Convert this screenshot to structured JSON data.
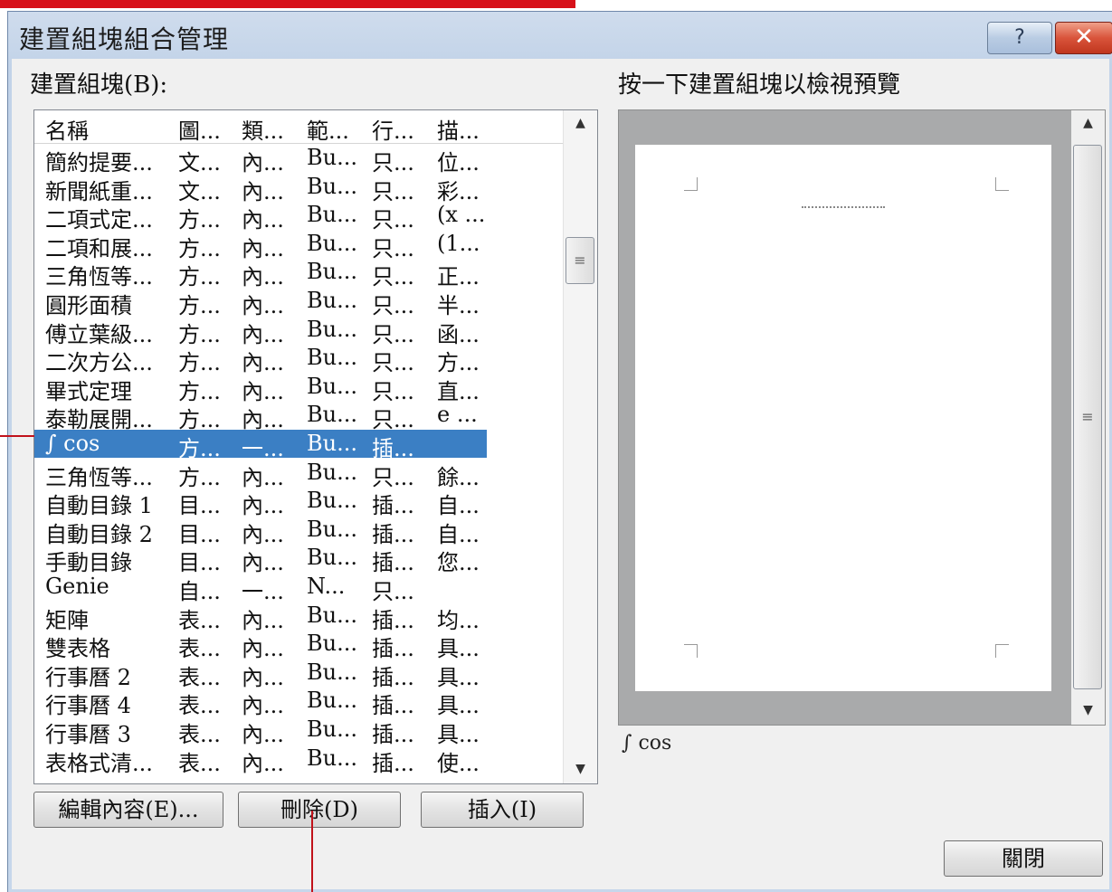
{
  "window": {
    "title": "建置組塊組合管理",
    "help_label": "?",
    "close_label": "✕"
  },
  "list_label": "建置組塊(B):",
  "preview_label": "按一下建置組塊以檢視預覽",
  "columns": [
    "名稱",
    "圖...",
    "類...",
    "範...",
    "行...",
    "描..."
  ],
  "rows": [
    [
      "簡約提要...",
      "文...",
      "內...",
      "Bu...",
      "只...",
      "位..."
    ],
    [
      "新聞紙重...",
      "文...",
      "內...",
      "Bu...",
      "只...",
      "彩..."
    ],
    [
      "二項式定...",
      "方...",
      "內...",
      "Bu...",
      "只...",
      "(x ..."
    ],
    [
      "二項和展...",
      "方...",
      "內...",
      "Bu...",
      "只...",
      "(1..."
    ],
    [
      "三角恆等...",
      "方...",
      "內...",
      "Bu...",
      "只...",
      "正..."
    ],
    [
      "圓形面積",
      "方...",
      "內...",
      "Bu...",
      "只...",
      "半..."
    ],
    [
      "傅立葉級...",
      "方...",
      "內...",
      "Bu...",
      "只...",
      "函..."
    ],
    [
      "二次方公...",
      "方...",
      "內...",
      "Bu...",
      "只...",
      "方..."
    ],
    [
      "畢式定理",
      "方...",
      "內...",
      "Bu...",
      "只...",
      "直..."
    ],
    [
      "泰勒展開...",
      "方...",
      "內...",
      "Bu...",
      "只...",
      "e ..."
    ],
    [
      "∫ cos",
      "方...",
      "一...",
      "Bu...",
      "插...",
      ""
    ],
    [
      "三角恆等...",
      "方...",
      "內...",
      "Bu...",
      "只...",
      "餘..."
    ],
    [
      "自動目錄 1",
      "目...",
      "內...",
      "Bu...",
      "插...",
      "自..."
    ],
    [
      "自動目錄 2",
      "目...",
      "內...",
      "Bu...",
      "插...",
      "自..."
    ],
    [
      "手動目錄",
      "目...",
      "內...",
      "Bu...",
      "插...",
      "您..."
    ],
    [
      "Genie",
      "自...",
      "一...",
      "N...",
      "只...",
      ""
    ],
    [
      "矩陣",
      "表...",
      "內...",
      "Bu...",
      "插...",
      "均..."
    ],
    [
      "雙表格",
      "表...",
      "內...",
      "Bu...",
      "插...",
      "具..."
    ],
    [
      "行事曆 2",
      "表...",
      "內...",
      "Bu...",
      "插...",
      "具..."
    ],
    [
      "行事曆 4",
      "表...",
      "內...",
      "Bu...",
      "插...",
      "具..."
    ],
    [
      "行事曆 3",
      "表...",
      "內...",
      "Bu...",
      "插...",
      "具..."
    ],
    [
      "表格式清...",
      "表...",
      "內...",
      "Bu...",
      "插...",
      "使..."
    ]
  ],
  "selected_row": 10,
  "buttons": {
    "edit": "編輯內容(E)...",
    "delete": "刪除(D)",
    "insert": "插入(I)",
    "close": "關閉"
  },
  "preview_caption": "∫ cos",
  "colors": {
    "selection": "#3b7fc4",
    "callout": "#c1121b",
    "close_button": "#d9543b"
  }
}
